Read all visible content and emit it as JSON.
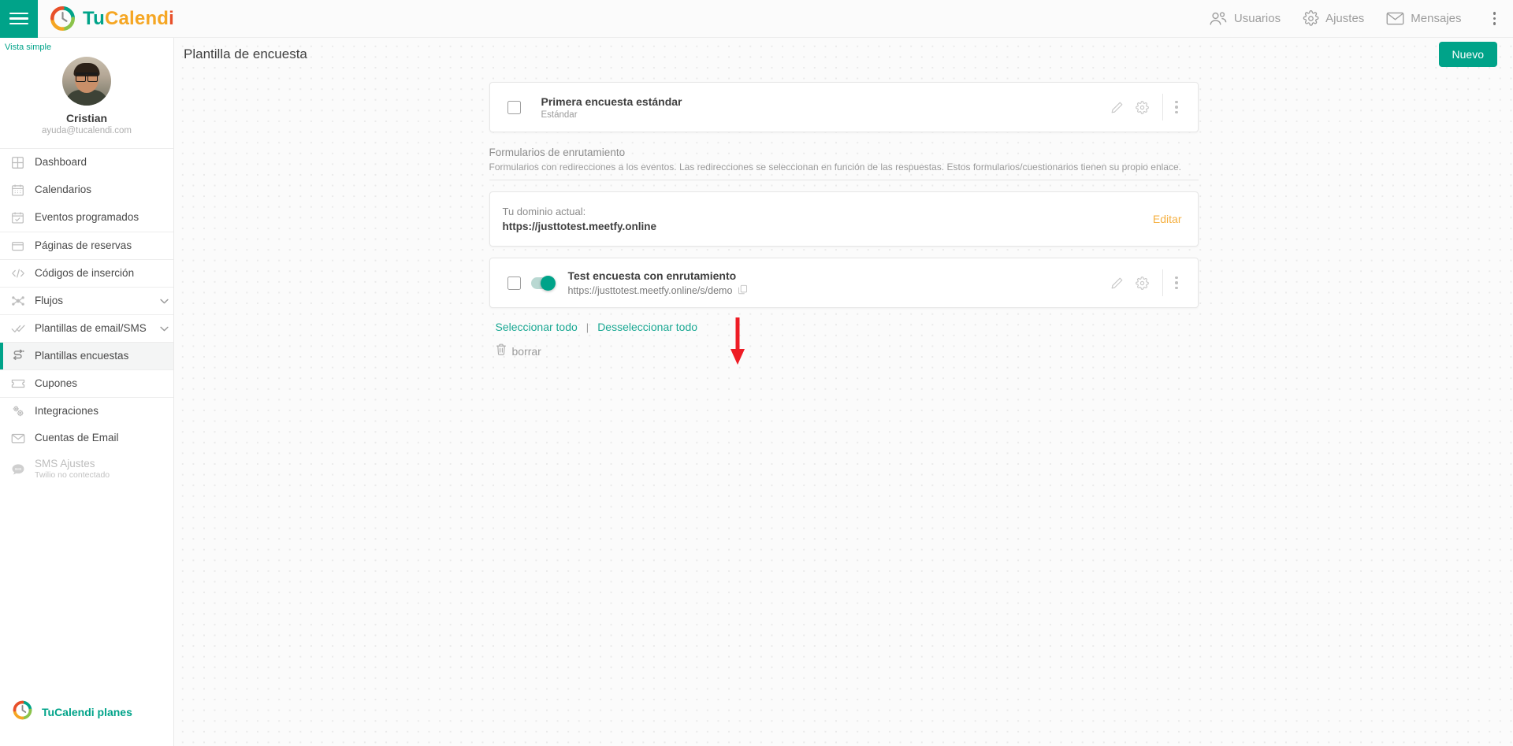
{
  "brand": {
    "part1": "Tu",
    "part2": "Calend",
    "part3": "i",
    "logo_icon": "tucalendi-logo-icon"
  },
  "topbar": {
    "menu_icon": "hamburger-icon",
    "items": [
      {
        "label": "Usuarios",
        "icon": "users-icon"
      },
      {
        "label": "Ajustes",
        "icon": "gear-icon"
      },
      {
        "label": "Mensajes",
        "icon": "envelope-icon"
      }
    ],
    "overflow_icon": "kebab-menu-icon"
  },
  "sidebar": {
    "view_mode": "Vista simple",
    "profile": {
      "name": "Cristian",
      "email": "ayuda@tucalendi.com",
      "avatar_icon": "user-avatar"
    },
    "items": [
      {
        "label": "Dashboard",
        "icon": "grid-icon",
        "state": "normal",
        "separator": false,
        "chevron": false
      },
      {
        "label": "Calendarios",
        "icon": "calendar-icon",
        "state": "normal",
        "separator": false,
        "chevron": false
      },
      {
        "label": "Eventos programados",
        "icon": "calendar-check-icon",
        "state": "normal",
        "separator": false,
        "chevron": false
      },
      {
        "label": "Páginas de reservas",
        "icon": "window-icon",
        "state": "normal",
        "separator": true,
        "chevron": false
      },
      {
        "label": "Códigos de inserción",
        "icon": "code-icon",
        "state": "normal",
        "separator": true,
        "chevron": false
      },
      {
        "label": "Flujos",
        "icon": "flow-icon",
        "state": "normal",
        "separator": true,
        "chevron": true
      },
      {
        "label": "Plantillas de email/SMS",
        "icon": "double-check-icon",
        "state": "normal",
        "separator": true,
        "chevron": true
      },
      {
        "label": "Plantillas encuestas",
        "icon": "survey-icon",
        "state": "active",
        "separator": true,
        "chevron": false
      },
      {
        "label": "Cupones",
        "icon": "ticket-icon",
        "state": "normal",
        "separator": true,
        "chevron": false
      },
      {
        "label": "Integraciones",
        "icon": "gears-icon",
        "state": "normal",
        "separator": true,
        "chevron": false
      },
      {
        "label": "Cuentas de Email",
        "icon": "envelope-icon",
        "state": "normal",
        "separator": false,
        "chevron": false
      },
      {
        "label": "SMS Ajustes",
        "sublabel": "Twilio no contectado",
        "icon": "sms-bubble-icon",
        "state": "disabled",
        "separator": false,
        "chevron": false
      }
    ],
    "plans": {
      "label": "TuCalendi planes",
      "icon": "tucalendi-logo-icon"
    }
  },
  "page": {
    "title": "Plantilla de encuesta",
    "new_button": "Nuevo"
  },
  "standard_survey": {
    "title": "Primera encuesta estándar",
    "subtitle": "Estándar",
    "checkbox_checked": false,
    "actions": {
      "edit_icon": "pencil-icon",
      "settings_icon": "gear-icon",
      "more_icon": "kebab-menu-icon"
    }
  },
  "routing_section": {
    "title": "Formularios de enrutamiento",
    "description": "Formularios con redirecciones a los eventos. Las redirecciones se seleccionan en función de las respuestas. Estos formularios/cuestionarios tienen su propio enlace."
  },
  "domain_card": {
    "label": "Tu dominio actual:",
    "value": "https://justtotest.meetfy.online",
    "edit_label": "Editar"
  },
  "routing_survey": {
    "title": "Test encuesta con enrutamiento",
    "url": "https://justtotest.meetfy.online/s/demo",
    "copy_icon": "copy-icon",
    "toggle_on": true,
    "checkbox_checked": false,
    "actions": {
      "edit_icon": "pencil-icon",
      "settings_icon": "gear-icon",
      "more_icon": "kebab-menu-icon"
    }
  },
  "bulk_actions": {
    "select_all": "Seleccionar todo",
    "separator": "|",
    "deselect_all": "Desseleccionar todo",
    "delete_label": "borrar",
    "delete_icon": "trash-icon"
  },
  "annotation": {
    "arrow_icon": "red-down-arrow",
    "color": "#ee1c25"
  },
  "colors": {
    "accent_teal": "#00a389",
    "brand_orange": "#f5a623",
    "brand_red": "#e8502a",
    "edit_amber": "#f5b041",
    "link_teal": "#1aa893"
  }
}
